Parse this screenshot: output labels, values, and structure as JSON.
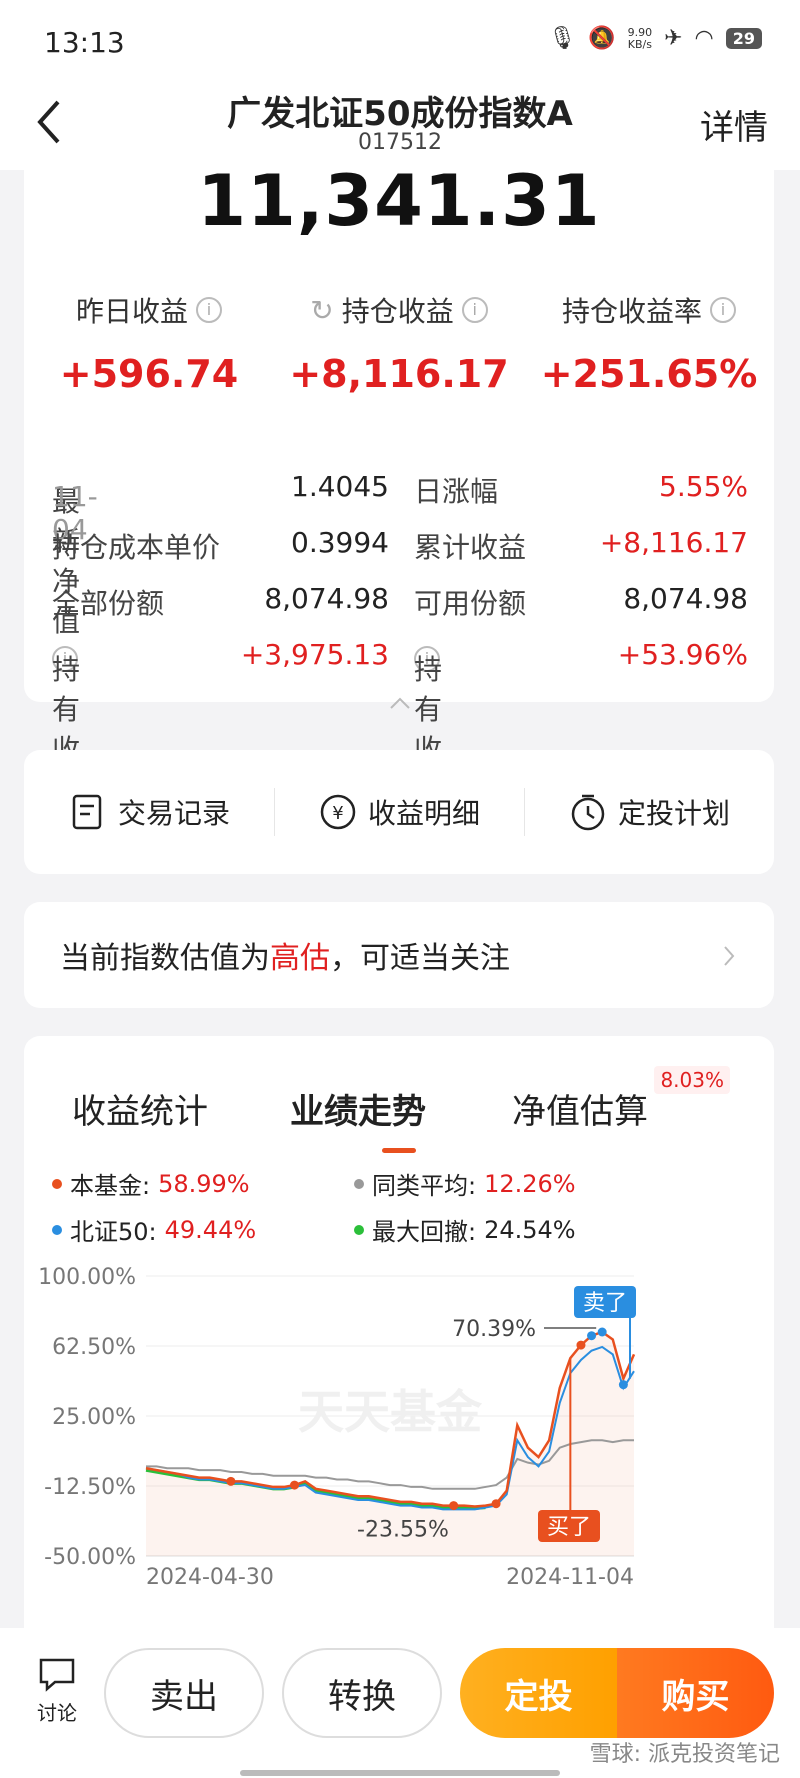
{
  "status": {
    "time": "13:13",
    "net_speed": "9.90",
    "net_unit": "KB/s",
    "battery": "29"
  },
  "header": {
    "title": "广发北证50成份指数A",
    "code": "017512",
    "detail": "详情"
  },
  "summary": {
    "total": "11,341.31",
    "metrics": [
      {
        "label": "昨日收益",
        "value": "+596.74"
      },
      {
        "label": "持仓收益",
        "value": "+8,116.17"
      },
      {
        "label": "持仓收益率",
        "value": "+251.65%"
      }
    ],
    "rows": [
      {
        "k1": "最新净值",
        "k1_date": "11-04",
        "v1": "1.4045",
        "k2": "日涨幅",
        "v2": "5.55%"
      },
      {
        "k1": "持仓成本单价",
        "v1": "0.3994",
        "k2": "累计收益",
        "v2": "+8,116.17"
      },
      {
        "k1": "全部份额",
        "v1": "8,074.98",
        "k2": "可用份额",
        "v2": "8,074.98"
      },
      {
        "k1": "持有收益",
        "v1": "+3,975.13",
        "k2": "持有收益率",
        "v2": "+53.96%"
      }
    ]
  },
  "actions": [
    "交易记录",
    "收益明细",
    "定投计划"
  ],
  "valuation": {
    "prefix": "当前指数估值为",
    "highlight": "高估",
    "suffix": "，可适当关注"
  },
  "chart_tabs": {
    "tabs": [
      "收益统计",
      "业绩走势",
      "净值估算"
    ],
    "badge": "8.03%"
  },
  "legend": [
    {
      "name": "本基金:",
      "value": "58.99%",
      "color": "#e8501f"
    },
    {
      "name": "同类平均:",
      "value": "12.26%",
      "color": "#999999"
    },
    {
      "name": "北证50:",
      "value": "49.44%",
      "color": "#2a8ee0"
    },
    {
      "name": "最大回撤:",
      "value": "24.54%",
      "color": "#2bbf3a"
    }
  ],
  "chart_data": {
    "type": "line",
    "ylim": [
      -50,
      100
    ],
    "yticks": [
      "100.00%",
      "62.50%",
      "25.00%",
      "-12.50%",
      "-50.00%"
    ],
    "xticks": [
      "2024-04-30",
      "2024-11-04"
    ],
    "watermark": "天天基金",
    "annotations": {
      "max": "70.39%",
      "min": "-23.55%",
      "sell_tag": "卖了",
      "buy_tag": "买了"
    },
    "series": [
      {
        "name": "本基金",
        "color": "#e8501f",
        "values": [
          -3,
          -4,
          -5,
          -6,
          -7,
          -8,
          -8,
          -9,
          -10,
          -10,
          -11,
          -12,
          -13,
          -13,
          -12,
          -10,
          -14,
          -15,
          -16,
          -17,
          -18,
          -18,
          -19,
          -20,
          -21,
          -21,
          -22,
          -22,
          -23,
          -23,
          -23,
          -23.5,
          -23,
          -22,
          -15,
          20,
          8,
          3,
          12,
          40,
          56,
          63,
          68,
          70,
          66,
          45,
          58
        ]
      },
      {
        "name": "北证50",
        "color": "#2a8ee0",
        "values": [
          -3,
          -4,
          -5,
          -6,
          -8,
          -9,
          -9,
          -10,
          -11,
          -11,
          -12,
          -13,
          -14,
          -14,
          -13,
          -12,
          -16,
          -17,
          -18,
          -19,
          -20,
          -20,
          -21,
          -22,
          -23,
          -23,
          -24,
          -24,
          -25,
          -25,
          -25,
          -25,
          -24,
          -23,
          -17,
          12,
          3,
          -2,
          6,
          32,
          48,
          55,
          60,
          62,
          58,
          40,
          49
        ]
      },
      {
        "name": "同类平均",
        "color": "#999999",
        "values": [
          -2,
          -2,
          -3,
          -3,
          -3,
          -4,
          -4,
          -4,
          -5,
          -5,
          -6,
          -6,
          -7,
          -7,
          -7,
          -7,
          -8,
          -8,
          -9,
          -9,
          -10,
          -10,
          -11,
          -12,
          -12,
          -13,
          -13,
          -14,
          -14,
          -14,
          -14,
          -14,
          -13,
          -12,
          -8,
          2,
          0,
          -1,
          1,
          8,
          10,
          11,
          12,
          12,
          11,
          12,
          12
        ]
      }
    ]
  },
  "bottom": {
    "discuss": "讨论",
    "sell": "卖出",
    "convert": "转换",
    "plan": "定投",
    "buy": "购买",
    "watermark": "雪球: 派克投资笔记"
  }
}
